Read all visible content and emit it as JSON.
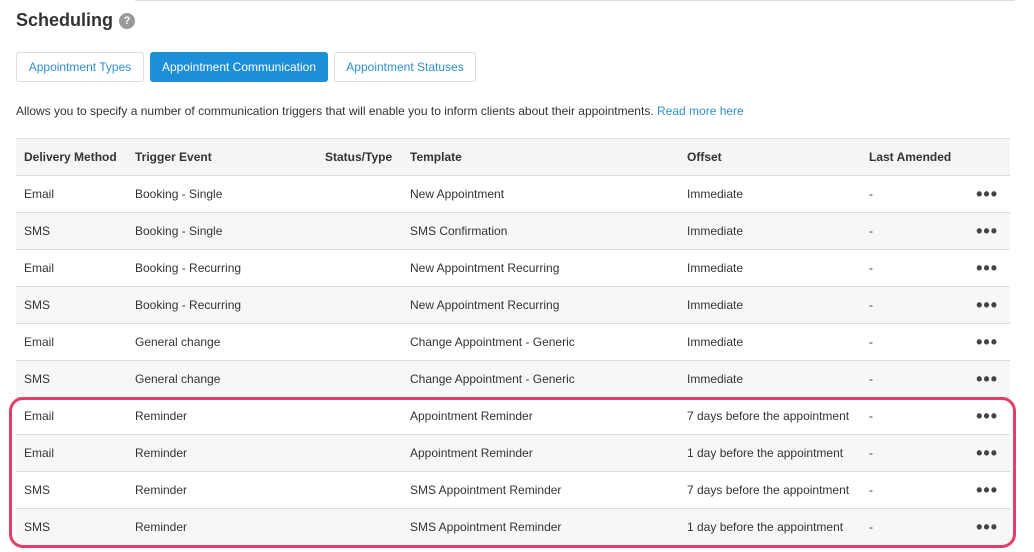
{
  "header": {
    "title": "Scheduling",
    "help_glyph": "?"
  },
  "tabs": [
    {
      "label": "Appointment Types",
      "active": false
    },
    {
      "label": "Appointment Communication",
      "active": true
    },
    {
      "label": "Appointment Statuses",
      "active": false
    }
  ],
  "description": {
    "text": "Allows you to specify a number of communication triggers that will enable you to inform clients about their appointments.",
    "link": "Read more here"
  },
  "table": {
    "columns": [
      "Delivery Method",
      "Trigger Event",
      "Status/Type",
      "Template",
      "Offset",
      "Last Amended"
    ],
    "rows": [
      [
        "Email",
        "Booking - Single",
        "",
        "New Appointment",
        "Immediate",
        "-"
      ],
      [
        "SMS",
        "Booking - Single",
        "",
        "SMS Confirmation",
        "Immediate",
        "-"
      ],
      [
        "Email",
        "Booking - Recurring",
        "",
        "New Appointment Recurring",
        "Immediate",
        "-"
      ],
      [
        "SMS",
        "Booking - Recurring",
        "",
        "New Appointment Recurring",
        "Immediate",
        "-"
      ],
      [
        "Email",
        "General change",
        "",
        "Change Appointment - Generic",
        "Immediate",
        "-"
      ],
      [
        "SMS",
        "General change",
        "",
        "Change Appointment - Generic",
        "Immediate",
        "-"
      ],
      [
        "Email",
        "Reminder",
        "",
        "Appointment Reminder",
        "7 days before the appointment",
        "-"
      ],
      [
        "Email",
        "Reminder",
        "",
        "Appointment Reminder",
        "1 day before the appointment",
        "-"
      ],
      [
        "SMS",
        "Reminder",
        "",
        "SMS Appointment Reminder",
        "7 days before the appointment",
        "-"
      ],
      [
        "SMS",
        "Reminder",
        "",
        "SMS Appointment Reminder",
        "1 day before the appointment",
        "-"
      ]
    ],
    "row_action_glyph": "•••"
  },
  "colors": {
    "accent": "#1d8ed8",
    "link": "#2d8fd1",
    "highlight": "#e23f67"
  }
}
